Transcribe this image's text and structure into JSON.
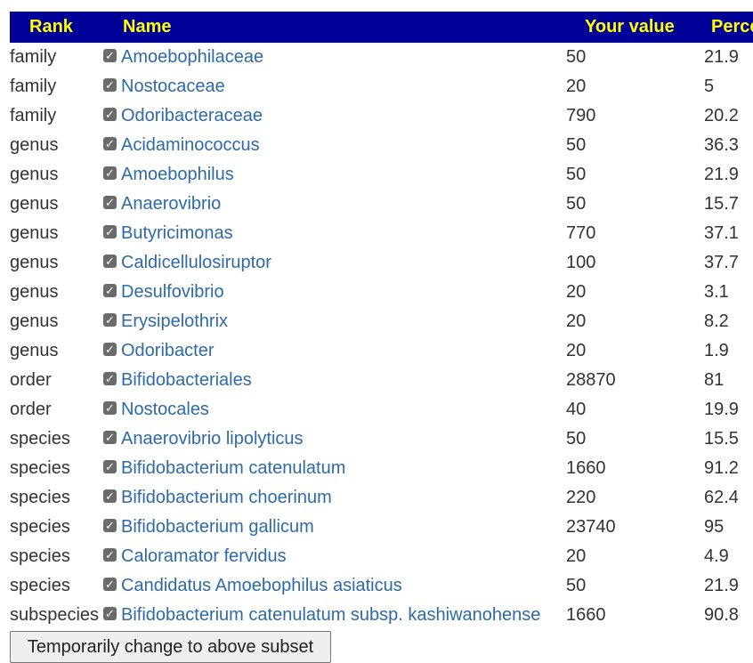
{
  "table": {
    "headers": {
      "rank": "Rank",
      "name": "Name",
      "value": "Your value",
      "percentile": "Percentile"
    },
    "rows": [
      {
        "rank": "family",
        "name": "Amoebophilaceae",
        "value": "50",
        "percentile": "21.9",
        "checked": true
      },
      {
        "rank": "family",
        "name": "Nostocaceae",
        "value": "20",
        "percentile": "5",
        "checked": true
      },
      {
        "rank": "family",
        "name": "Odoribacteraceae",
        "value": "790",
        "percentile": "20.2",
        "checked": true
      },
      {
        "rank": "genus",
        "name": "Acidaminococcus",
        "value": "50",
        "percentile": "36.3",
        "checked": true
      },
      {
        "rank": "genus",
        "name": "Amoebophilus",
        "value": "50",
        "percentile": "21.9",
        "checked": true
      },
      {
        "rank": "genus",
        "name": "Anaerovibrio",
        "value": "50",
        "percentile": "15.7",
        "checked": true
      },
      {
        "rank": "genus",
        "name": "Butyricimonas",
        "value": "770",
        "percentile": "37.1",
        "checked": true
      },
      {
        "rank": "genus",
        "name": "Caldicellulosiruptor",
        "value": "100",
        "percentile": "37.7",
        "checked": true
      },
      {
        "rank": "genus",
        "name": "Desulfovibrio",
        "value": "20",
        "percentile": "3.1",
        "checked": true
      },
      {
        "rank": "genus",
        "name": "Erysipelothrix",
        "value": "20",
        "percentile": "8.2",
        "checked": true
      },
      {
        "rank": "genus",
        "name": "Odoribacter",
        "value": "20",
        "percentile": "1.9",
        "checked": true
      },
      {
        "rank": "order",
        "name": "Bifidobacteriales",
        "value": "28870",
        "percentile": "81",
        "checked": true
      },
      {
        "rank": "order",
        "name": "Nostocales",
        "value": "40",
        "percentile": "19.9",
        "checked": true
      },
      {
        "rank": "species",
        "name": "Anaerovibrio lipolyticus",
        "value": "50",
        "percentile": "15.5",
        "checked": true
      },
      {
        "rank": "species",
        "name": "Bifidobacterium catenulatum",
        "value": "1660",
        "percentile": "91.2",
        "checked": true
      },
      {
        "rank": "species",
        "name": "Bifidobacterium choerinum",
        "value": "220",
        "percentile": "62.4",
        "checked": true
      },
      {
        "rank": "species",
        "name": "Bifidobacterium gallicum",
        "value": "23740",
        "percentile": "95",
        "checked": true
      },
      {
        "rank": "species",
        "name": "Caloramator fervidus",
        "value": "20",
        "percentile": "4.9",
        "checked": true
      },
      {
        "rank": "species",
        "name": "Candidatus Amoebophilus asiaticus",
        "value": "50",
        "percentile": "21.9",
        "checked": true
      },
      {
        "rank": "subspecies",
        "name": "Bifidobacterium catenulatum subsp. kashiwanohense",
        "value": "1660",
        "percentile": "90.8",
        "checked": true
      }
    ]
  },
  "actions": {
    "subset_button": "Temporarily change to above subset"
  },
  "colors": {
    "header_bg": "#000099",
    "header_text": "#ffff00",
    "link": "#2d6aa8",
    "text": "#333333"
  },
  "icons": {
    "checkbox": "checkbox-checked-icon"
  }
}
